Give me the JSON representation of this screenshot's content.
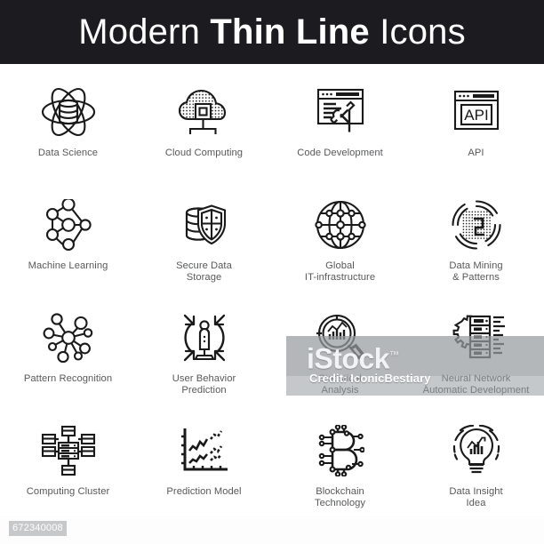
{
  "header": {
    "title_part1": "Modern ",
    "title_part2": "Thin Line",
    "title_part3": " Icons"
  },
  "grid": {
    "items": [
      {
        "icon": "atom-database-icon",
        "label": "Data Science"
      },
      {
        "icon": "cloud-chip-icon",
        "label": "Cloud Computing"
      },
      {
        "icon": "browser-tools-icon",
        "label": "Code Development"
      },
      {
        "icon": "browser-api-icon",
        "label": "API"
      },
      {
        "icon": "neural-nodes-icon",
        "label": "Machine Learning"
      },
      {
        "icon": "database-shield-icon",
        "label": "Secure Data\nStorage"
      },
      {
        "icon": "globe-network-icon",
        "label": "Global\nIT-infrastructure"
      },
      {
        "icon": "radar-pattern-icon",
        "label": "Data Mining\n& Patterns"
      },
      {
        "icon": "hub-nodes-icon",
        "label": "Pattern Recognition"
      },
      {
        "icon": "person-arrows-icon",
        "label": "User Behavior\nPrediction"
      },
      {
        "icon": "magnifier-chart-icon",
        "label": "Statistical\nAnalysis"
      },
      {
        "icon": "server-gear-code-icon",
        "label": "Neural Network\nAutomatic Development"
      },
      {
        "icon": "server-cluster-icon",
        "label": "Computing Cluster"
      },
      {
        "icon": "trend-chart-icon",
        "label": "Prediction Model"
      },
      {
        "icon": "circuit-b-icon",
        "label": "Blockchain\nTechnology"
      },
      {
        "icon": "lightbulb-chart-icon",
        "label": "Data Insight\nIdea"
      }
    ]
  },
  "browser_api_text": "API",
  "watermark": {
    "brand": "iStock",
    "trademark": "™",
    "credit": "Credit: IconicBestiary"
  },
  "footer": {
    "asset_id": "672340008"
  },
  "colors": {
    "header_bg": "#1b1b20",
    "page_bg": "#ffffff",
    "icon_stroke": "#1a1a1a",
    "label_text": "#58595b",
    "watermark_band": "#969b9e",
    "footer_id_bg": "#c7c8ca"
  }
}
